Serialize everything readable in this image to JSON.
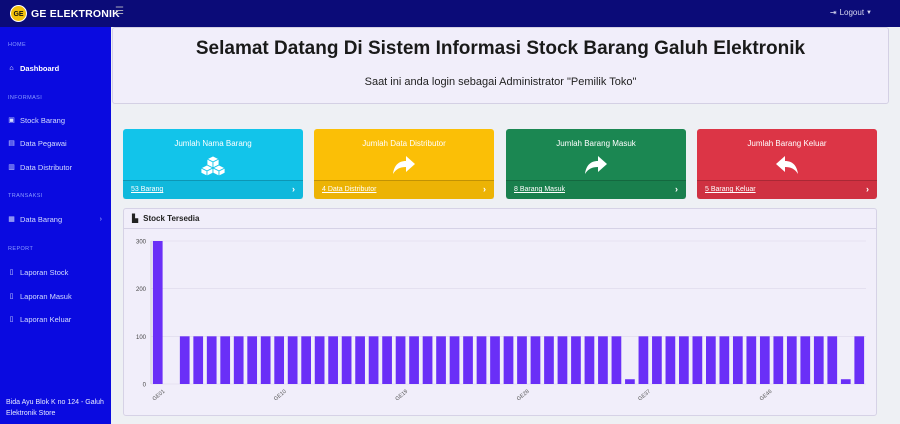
{
  "app": {
    "logo_text": "GE",
    "brand": "GE ELEKTRONIK",
    "logout": "Logout"
  },
  "sidebar": {
    "sections": [
      {
        "title": "HOME",
        "items": [
          {
            "label": "Dashboard",
            "icon": "home-icon",
            "active": true
          }
        ]
      },
      {
        "title": "INFORMASI",
        "items": [
          {
            "label": "Stock Barang",
            "icon": "box-icon"
          },
          {
            "label": "Data Pegawai",
            "icon": "users-icon"
          },
          {
            "label": "Data Distributor",
            "icon": "truck-icon"
          }
        ]
      },
      {
        "title": "TRANSAKSI",
        "items": [
          {
            "label": "Data Barang",
            "icon": "table-icon",
            "has_children": true
          }
        ]
      },
      {
        "title": "REPORT",
        "items": [
          {
            "label": "Laporan Stock",
            "icon": "file-icon"
          },
          {
            "label": "Laporan Masuk",
            "icon": "file-icon"
          },
          {
            "label": "Laporan Keluar",
            "icon": "file-icon"
          }
        ]
      }
    ],
    "footer": "Bida Ayu Blok K no 124 - Galuh Elektronik Store"
  },
  "welcome": {
    "title": "Selamat Datang Di Sistem Informasi Stock Barang Galuh Elektronik",
    "subtitle": "Saat ini anda login sebagai Administrator \"Pemilik Toko\""
  },
  "cards": [
    {
      "title": "Jumlah Nama Barang",
      "link": "53 Barang",
      "color": "#12c4ea",
      "icon": "cubes-icon"
    },
    {
      "title": "Jumlah Data Distributor",
      "link": "4 Data Distributor",
      "color": "#fbbf06",
      "icon": "share-icon"
    },
    {
      "title": "Jumlah Barang Masuk",
      "link": "8 Barang Masuk",
      "color": "#1b8752",
      "icon": "share-icon"
    },
    {
      "title": "Jumlah Barang Keluar",
      "link": "5 Barang Keluar",
      "color": "#dc3546",
      "icon": "reply-icon"
    }
  ],
  "chart_panel": {
    "title": "Stock Tersedia"
  },
  "chart_data": {
    "type": "bar",
    "bar_color": "#6a2ff7",
    "ylim": [
      0,
      300
    ],
    "yticks": [
      0,
      100,
      200,
      300
    ],
    "x_tick_labels": [
      {
        "index": 0,
        "label": "GE01"
      },
      {
        "index": 9,
        "label": "GE10"
      },
      {
        "index": 18,
        "label": "GE19"
      },
      {
        "index": 27,
        "label": "GE28"
      },
      {
        "index": 36,
        "label": "GE37"
      },
      {
        "index": 45,
        "label": "GE46"
      }
    ],
    "values": [
      300,
      0,
      100,
      100,
      100,
      100,
      100,
      100,
      100,
      100,
      100,
      100,
      100,
      100,
      100,
      100,
      100,
      100,
      100,
      100,
      100,
      100,
      100,
      100,
      100,
      100,
      100,
      100,
      100,
      100,
      100,
      100,
      100,
      100,
      100,
      10,
      100,
      100,
      100,
      100,
      100,
      100,
      100,
      100,
      100,
      100,
      100,
      100,
      100,
      100,
      100,
      10,
      100
    ]
  }
}
